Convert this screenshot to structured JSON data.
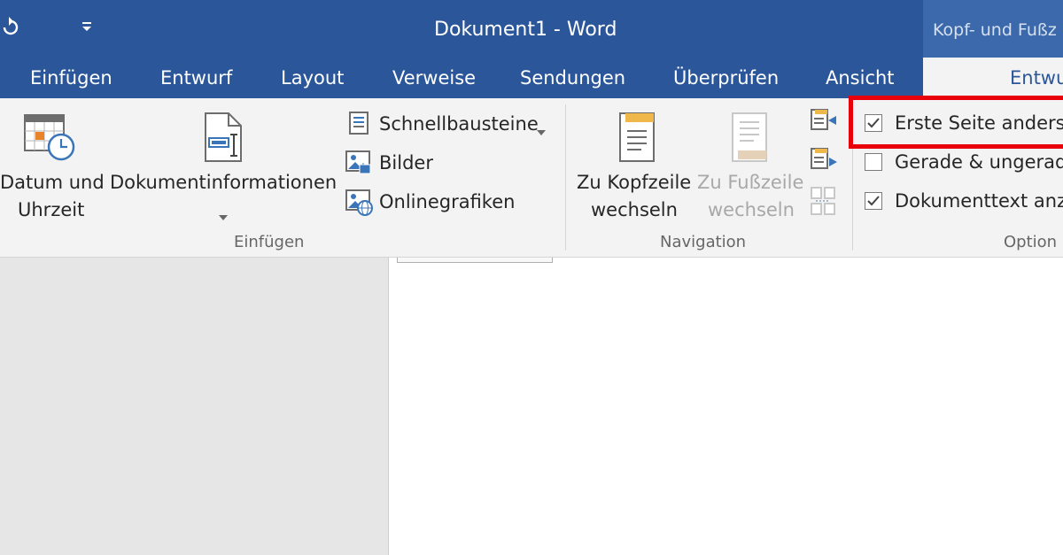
{
  "window": {
    "title": "Dokument1 - Word",
    "contextual_title": "Kopf- und Fußz",
    "quick_access_redo_icon": "redo-icon",
    "quick_access_customize_icon": "customize-quick-access-icon"
  },
  "tabs": [
    {
      "label": "Einfügen"
    },
    {
      "label": "Entwurf"
    },
    {
      "label": "Layout"
    },
    {
      "label": "Verweise"
    },
    {
      "label": "Sendungen"
    },
    {
      "label": "Überprüfen"
    },
    {
      "label": "Ansicht"
    },
    {
      "label": "Entwu",
      "active": true
    }
  ],
  "ribbon": {
    "insert_group": {
      "label": "Einfügen",
      "date_time": {
        "line1": "Datum und",
        "line2": "Uhrzeit",
        "icon": "calendar-clock-icon"
      },
      "doc_info": {
        "label": "Dokumentinformationen",
        "icon": "document-info-icon"
      },
      "quick_parts": {
        "label": "Schnellbausteine",
        "icon": "quick-parts-icon"
      },
      "pictures": {
        "label": "Bilder",
        "icon": "picture-icon"
      },
      "online_pictures": {
        "label": "Onlinegrafiken",
        "icon": "online-picture-icon"
      }
    },
    "navigation_group": {
      "label": "Navigation",
      "goto_header": {
        "line1": "Zu Kopfzeile",
        "line2": "wechseln",
        "icon": "header-icon"
      },
      "goto_footer": {
        "line1": "Zu Fußzeile",
        "line2": "wechseln",
        "icon": "footer-icon",
        "enabled": false
      }
    },
    "options_group": {
      "label": "Option",
      "first_page": {
        "label": "Erste Seite anders",
        "checked": true,
        "highlighted": true
      },
      "odd_even": {
        "label": "Gerade & ungerade",
        "checked": false
      },
      "show_doc_text": {
        "label": "Dokumenttext anze",
        "checked": true
      }
    }
  },
  "colors": {
    "title_bar": "#2b579a",
    "ribbon_bg": "#f3f3f3",
    "highlight": "#e8000b",
    "nav_pane": "#e6e6e6"
  }
}
